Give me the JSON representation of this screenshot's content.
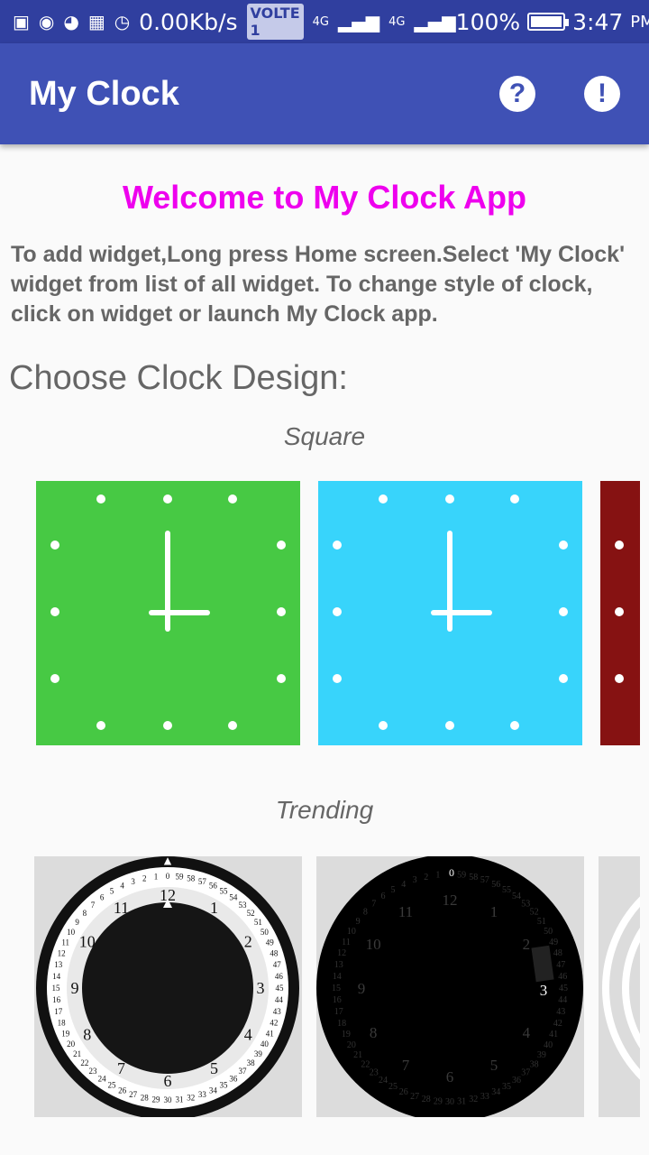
{
  "status_bar": {
    "network_speed": "0.00Kb/s",
    "volte": "VOLTE 1",
    "sim1": "4G",
    "sim2": "4G",
    "battery": "100%",
    "battery_level": 1.0,
    "time": "3:47",
    "ampm": "PM"
  },
  "appbar": {
    "title": "My Clock",
    "help_icon": "help-icon",
    "info_icon": "info-icon",
    "help_glyph": "?",
    "info_glyph": "!"
  },
  "main": {
    "welcome": "Welcome to My Clock App",
    "instructions": "To add widget,Long press Home screen.Select 'My Clock' widget from list of all widget. To change style of clock, click on widget or launch My Clock app.",
    "choose_heading": "Choose Clock Design:",
    "sections": [
      {
        "label": "Square"
      },
      {
        "label": "Trending"
      }
    ]
  },
  "square_tiles": [
    {
      "name": "green",
      "color": "#47c944"
    },
    {
      "name": "cyan",
      "color": "#38d4fb"
    },
    {
      "name": "darkred",
      "color": "#861212"
    }
  ],
  "trending_tiles": [
    {
      "name": "white-dial",
      "ring_numbers": "12 11 10 9 8 7 6 5 4 3 2 1"
    },
    {
      "name": "black-dial",
      "ring_numbers": "12 11 10 9 8 7 6 5 4 3 2 1"
    },
    {
      "name": "rings-dial"
    }
  ]
}
